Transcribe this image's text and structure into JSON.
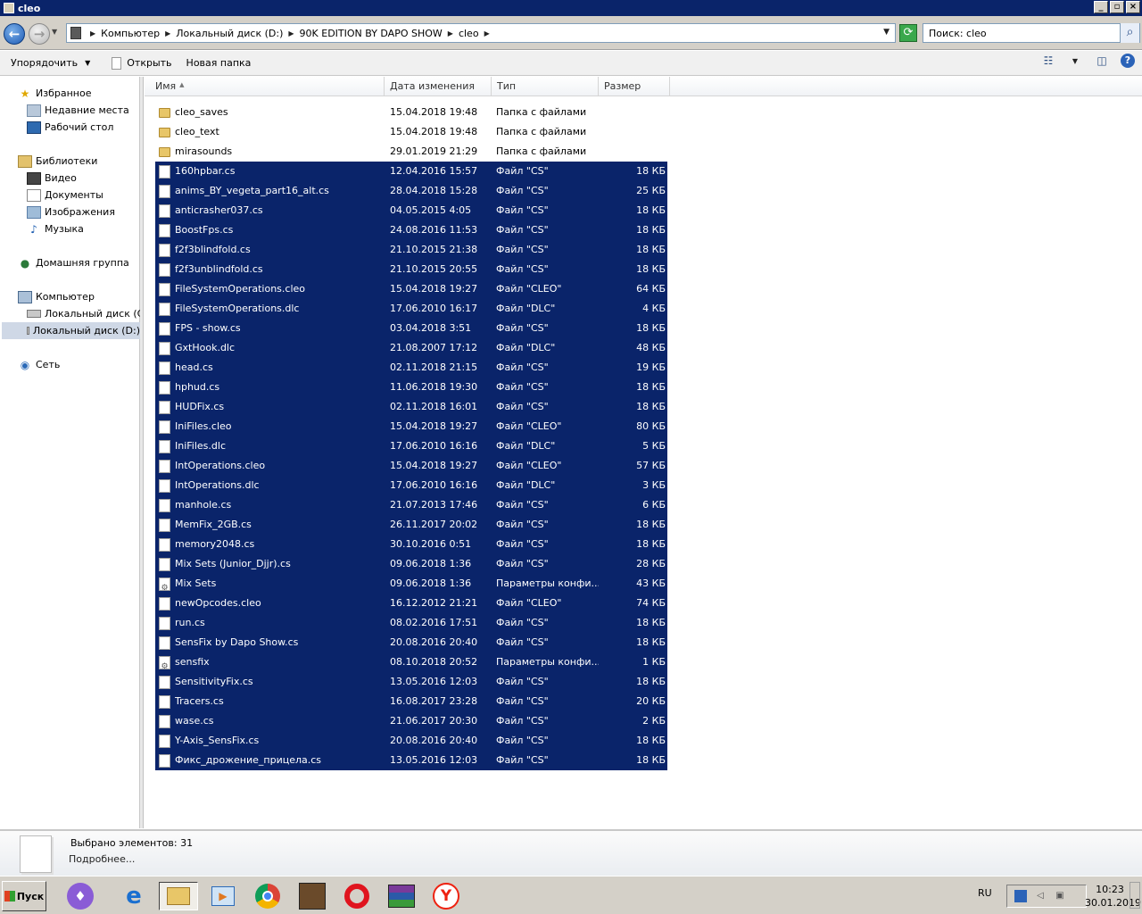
{
  "window": {
    "title": "cleo"
  },
  "address": {
    "crumbs": [
      "Компьютер",
      "Локальный диск (D:)",
      "90K EDITION BY DAPO SHOW",
      "cleo"
    ]
  },
  "search": {
    "value": "Поиск: cleo"
  },
  "toolbar": {
    "organize_label": "Упорядочить",
    "open_label": "Открыть",
    "new_folder_label": "Новая папка"
  },
  "nav": {
    "favorites": "Избранное",
    "recent": "Недавние места",
    "desktop": "Рабочий стол",
    "libraries": "Библиотеки",
    "video": "Видео",
    "documents": "Документы",
    "images": "Изображения",
    "music": "Музыка",
    "homegroup": "Домашняя группа",
    "computer": "Компьютер",
    "disk_c": "Локальный диск (C:)",
    "disk_d": "Локальный диск (D:)",
    "network": "Сеть"
  },
  "columns": {
    "name": "Имя",
    "date": "Дата изменения",
    "type": "Тип",
    "size": "Размер"
  },
  "files": [
    {
      "name": "cleo_saves",
      "date": "15.04.2018 19:48",
      "type": "Папка с файлами",
      "size": "",
      "kind": "folder",
      "selected": false
    },
    {
      "name": "cleo_text",
      "date": "15.04.2018 19:48",
      "type": "Папка с файлами",
      "size": "",
      "kind": "folder",
      "selected": false
    },
    {
      "name": "mirasounds",
      "date": "29.01.2019 21:29",
      "type": "Папка с файлами",
      "size": "",
      "kind": "folder",
      "selected": false
    },
    {
      "name": "160hpbar.cs",
      "date": "12.04.2016 15:57",
      "type": "Файл \"CS\"",
      "size": "18 КБ",
      "kind": "file",
      "selected": true
    },
    {
      "name": "anims_BY_vegeta_part16_alt.cs",
      "date": "28.04.2018 15:28",
      "type": "Файл \"CS\"",
      "size": "25 КБ",
      "kind": "file",
      "selected": true
    },
    {
      "name": "anticrasher037.cs",
      "date": "04.05.2015 4:05",
      "type": "Файл \"CS\"",
      "size": "18 КБ",
      "kind": "file",
      "selected": true
    },
    {
      "name": "BoostFps.cs",
      "date": "24.08.2016 11:53",
      "type": "Файл \"CS\"",
      "size": "18 КБ",
      "kind": "file",
      "selected": true
    },
    {
      "name": "f2f3blindfold.cs",
      "date": "21.10.2015 21:38",
      "type": "Файл \"CS\"",
      "size": "18 КБ",
      "kind": "file",
      "selected": true
    },
    {
      "name": "f2f3unblindfold.cs",
      "date": "21.10.2015 20:55",
      "type": "Файл \"CS\"",
      "size": "18 КБ",
      "kind": "file",
      "selected": true
    },
    {
      "name": "FileSystemOperations.cleo",
      "date": "15.04.2018 19:27",
      "type": "Файл \"CLEO\"",
      "size": "64 КБ",
      "kind": "file",
      "selected": true
    },
    {
      "name": "FileSystemOperations.dlc",
      "date": "17.06.2010 16:17",
      "type": "Файл \"DLC\"",
      "size": "4 КБ",
      "kind": "file",
      "selected": true
    },
    {
      "name": "FPS - show.cs",
      "date": "03.04.2018 3:51",
      "type": "Файл \"CS\"",
      "size": "18 КБ",
      "kind": "file",
      "selected": true
    },
    {
      "name": "GxtHook.dlc",
      "date": "21.08.2007 17:12",
      "type": "Файл \"DLC\"",
      "size": "48 КБ",
      "kind": "file",
      "selected": true
    },
    {
      "name": "head.cs",
      "date": "02.11.2018 21:15",
      "type": "Файл \"CS\"",
      "size": "19 КБ",
      "kind": "file",
      "selected": true
    },
    {
      "name": "hphud.cs",
      "date": "11.06.2018 19:30",
      "type": "Файл \"CS\"",
      "size": "18 КБ",
      "kind": "file",
      "selected": true
    },
    {
      "name": "HUDFix.cs",
      "date": "02.11.2018 16:01",
      "type": "Файл \"CS\"",
      "size": "18 КБ",
      "kind": "file",
      "selected": true
    },
    {
      "name": "IniFiles.cleo",
      "date": "15.04.2018 19:27",
      "type": "Файл \"CLEO\"",
      "size": "80 КБ",
      "kind": "file",
      "selected": true
    },
    {
      "name": "IniFiles.dlc",
      "date": "17.06.2010 16:16",
      "type": "Файл \"DLC\"",
      "size": "5 КБ",
      "kind": "file",
      "selected": true
    },
    {
      "name": "IntOperations.cleo",
      "date": "15.04.2018 19:27",
      "type": "Файл \"CLEO\"",
      "size": "57 КБ",
      "kind": "file",
      "selected": true
    },
    {
      "name": "IntOperations.dlc",
      "date": "17.06.2010 16:16",
      "type": "Файл \"DLC\"",
      "size": "3 КБ",
      "kind": "file",
      "selected": true
    },
    {
      "name": "manhole.cs",
      "date": "21.07.2013 17:46",
      "type": "Файл \"CS\"",
      "size": "6 КБ",
      "kind": "file",
      "selected": true
    },
    {
      "name": "MemFix_2GB.cs",
      "date": "26.11.2017 20:02",
      "type": "Файл \"CS\"",
      "size": "18 КБ",
      "kind": "file",
      "selected": true
    },
    {
      "name": "memory2048.cs",
      "date": "30.10.2016 0:51",
      "type": "Файл \"CS\"",
      "size": "18 КБ",
      "kind": "file",
      "selected": true
    },
    {
      "name": "Mix Sets (Junior_Djjr).cs",
      "date": "09.06.2018 1:36",
      "type": "Файл \"CS\"",
      "size": "28 КБ",
      "kind": "file",
      "selected": true
    },
    {
      "name": "Mix Sets",
      "date": "09.06.2018 1:36",
      "type": "Параметры конфи...",
      "size": "43 КБ",
      "kind": "config",
      "selected": true
    },
    {
      "name": "newOpcodes.cleo",
      "date": "16.12.2012 21:21",
      "type": "Файл \"CLEO\"",
      "size": "74 КБ",
      "kind": "file",
      "selected": true
    },
    {
      "name": "run.cs",
      "date": "08.02.2016 17:51",
      "type": "Файл \"CS\"",
      "size": "18 КБ",
      "kind": "file",
      "selected": true
    },
    {
      "name": "SensFix by Dapo Show.cs",
      "date": "20.08.2016 20:40",
      "type": "Файл \"CS\"",
      "size": "18 КБ",
      "kind": "file",
      "selected": true
    },
    {
      "name": "sensfix",
      "date": "08.10.2018 20:52",
      "type": "Параметры конфи...",
      "size": "1 КБ",
      "kind": "config",
      "selected": true
    },
    {
      "name": "SensitivityFix.cs",
      "date": "13.05.2016 12:03",
      "type": "Файл \"CS\"",
      "size": "18 КБ",
      "kind": "file",
      "selected": true
    },
    {
      "name": "Tracers.cs",
      "date": "16.08.2017 23:28",
      "type": "Файл \"CS\"",
      "size": "20 КБ",
      "kind": "file",
      "selected": true
    },
    {
      "name": "wase.cs",
      "date": "21.06.2017 20:30",
      "type": "Файл \"CS\"",
      "size": "2 КБ",
      "kind": "file",
      "selected": true
    },
    {
      "name": "Y-Axis_SensFix.cs",
      "date": "20.08.2016 20:40",
      "type": "Файл \"CS\"",
      "size": "18 КБ",
      "kind": "file",
      "selected": true
    },
    {
      "name": "Фикс_дрожение_прицела.cs",
      "date": "13.05.2016 12:03",
      "type": "Файл \"CS\"",
      "size": "18 КБ",
      "kind": "file",
      "selected": true
    }
  ],
  "details": {
    "selected_count": "Выбрано элементов: 31",
    "more": "Подробнее..."
  },
  "taskbar": {
    "start_label": "Пуск",
    "lang": "RU",
    "time": "10:23",
    "date": "30.01.2019"
  },
  "colors": {
    "selection": "#0a246a",
    "titlebar": "#0a246a",
    "folder": "#e8c668"
  }
}
